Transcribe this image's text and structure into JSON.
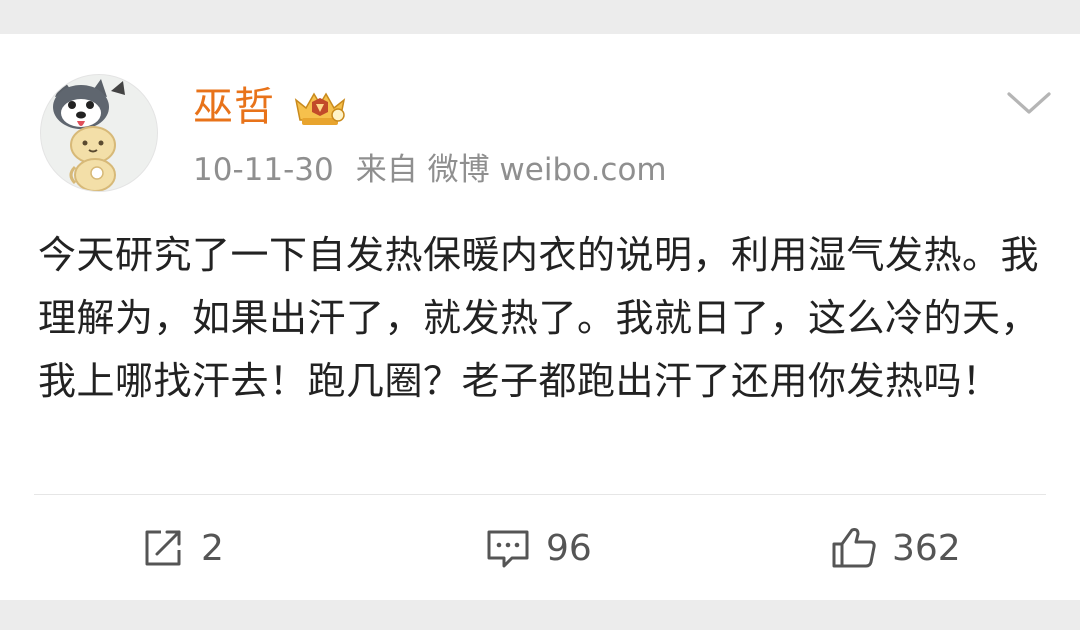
{
  "post": {
    "username": "巫哲",
    "date": "10-11-30",
    "source": "来自 微博 weibo.com",
    "content": "今天研究了一下自发热保暖内衣的说明，利用湿气发热。我理解为，如果出汗了，就发热了。我就日了，这么冷的天，我上哪找汗去！跑几圈？老子都跑出汗了还用你发热吗！"
  },
  "icons": {
    "avatar": "cartoon-dog-avatar",
    "badge": "vip-crown-icon",
    "menu": "chevron-down-icon",
    "repost": "repost-icon",
    "comment": "comment-icon",
    "like": "thumbs-up-icon"
  },
  "actions": {
    "repost_count": "2",
    "comment_count": "96",
    "like_count": "362"
  },
  "colors": {
    "username": "#e8731a",
    "meta": "#8f8f8f",
    "text": "#222222",
    "background": "#ececec"
  }
}
